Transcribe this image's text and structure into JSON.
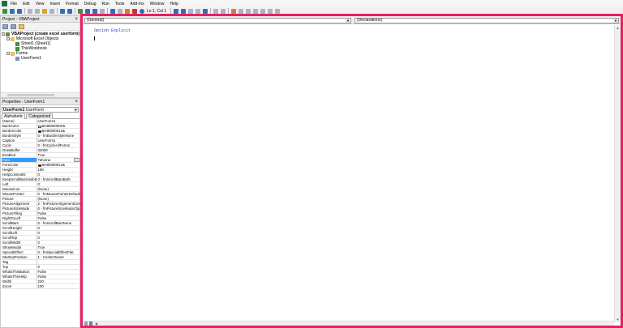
{
  "menu": [
    "File",
    "Edit",
    "View",
    "Insert",
    "Format",
    "Debug",
    "Run",
    "Tools",
    "Add-Ins",
    "Window",
    "Help"
  ],
  "toolbar": {
    "cursor_position": "Ln 1, Col 1"
  },
  "project": {
    "title": "Project - VBAProject",
    "tree": [
      {
        "label": "VBAProject (create excel userform)",
        "level": 0,
        "icon": "project-icon",
        "bold": true,
        "expander": "-"
      },
      {
        "label": "Microsoft Excel Objects",
        "level": 1,
        "icon": "folder-icon",
        "bold": false,
        "expander": "-"
      },
      {
        "label": "Sheet1 (Sheet1)",
        "level": 2,
        "icon": "worksheet-icon",
        "bold": false,
        "expander": ""
      },
      {
        "label": "ThisWorkbook",
        "level": 2,
        "icon": "workbook-icon",
        "bold": false,
        "expander": ""
      },
      {
        "label": "Forms",
        "level": 1,
        "icon": "folder-icon",
        "bold": false,
        "expander": "-"
      },
      {
        "label": "UserForm1",
        "level": 2,
        "icon": "userform-icon",
        "bold": false,
        "expander": ""
      }
    ]
  },
  "properties": {
    "title": "Properties - UserForm1",
    "object_name": "UserForm1",
    "object_type": "UserForm",
    "tabs": [
      "Alphabetic",
      "Categorized"
    ],
    "selected": "Font",
    "rows": [
      {
        "name": "(Name)",
        "value": "UserForm1"
      },
      {
        "name": "BackColor",
        "value": "&H8000000F&",
        "swatch": "#f0f0f0"
      },
      {
        "name": "BorderColor",
        "value": "&H80000012&",
        "swatch": "#000000"
      },
      {
        "name": "BorderStyle",
        "value": "0 - fmBorderStyleNone"
      },
      {
        "name": "Caption",
        "value": "UserForm1"
      },
      {
        "name": "Cycle",
        "value": "0 - fmCycleAllForms"
      },
      {
        "name": "DrawBuffer",
        "value": "32000"
      },
      {
        "name": "Enabled",
        "value": "True"
      },
      {
        "name": "Font",
        "value": "Tahoma"
      },
      {
        "name": "ForeColor",
        "value": "&H80000012&",
        "swatch": "#000000"
      },
      {
        "name": "Height",
        "value": "180"
      },
      {
        "name": "HelpContextID",
        "value": "0"
      },
      {
        "name": "KeepScrollBarsVisible",
        "value": "3 - fmScrollBarsBoth"
      },
      {
        "name": "Left",
        "value": "0"
      },
      {
        "name": "MouseIcon",
        "value": "(None)"
      },
      {
        "name": "MousePointer",
        "value": "0 - fmMousePointerDefault"
      },
      {
        "name": "Picture",
        "value": "(None)"
      },
      {
        "name": "PictureAlignment",
        "value": "2 - fmPictureAlignmentCenter"
      },
      {
        "name": "PictureSizeMode",
        "value": "0 - fmPictureSizeModeClip"
      },
      {
        "name": "PictureTiling",
        "value": "False"
      },
      {
        "name": "RightToLeft",
        "value": "False"
      },
      {
        "name": "ScrollBars",
        "value": "0 - fmScrollBarsNone"
      },
      {
        "name": "ScrollHeight",
        "value": "0"
      },
      {
        "name": "ScrollLeft",
        "value": "0"
      },
      {
        "name": "ScrollTop",
        "value": "0"
      },
      {
        "name": "ScrollWidth",
        "value": "0"
      },
      {
        "name": "ShowModal",
        "value": "True"
      },
      {
        "name": "SpecialEffect",
        "value": "0 - fmSpecialEffectFlat"
      },
      {
        "name": "StartUpPosition",
        "value": "1 - CenterOwner"
      },
      {
        "name": "Tag",
        "value": ""
      },
      {
        "name": "Top",
        "value": "0"
      },
      {
        "name": "WhatsThisButton",
        "value": "False"
      },
      {
        "name": "WhatsThisHelp",
        "value": "False"
      },
      {
        "name": "Width",
        "value": "240"
      },
      {
        "name": "Zoom",
        "value": "100"
      }
    ]
  },
  "code": {
    "object_combo": "(General)",
    "procedure_combo": "(Declarations)",
    "lines": [
      "Option Explicit"
    ]
  },
  "colors": {
    "code_window_border": "#e91e63",
    "keyword": "#1f3fa0",
    "selection": "#3399ff"
  }
}
